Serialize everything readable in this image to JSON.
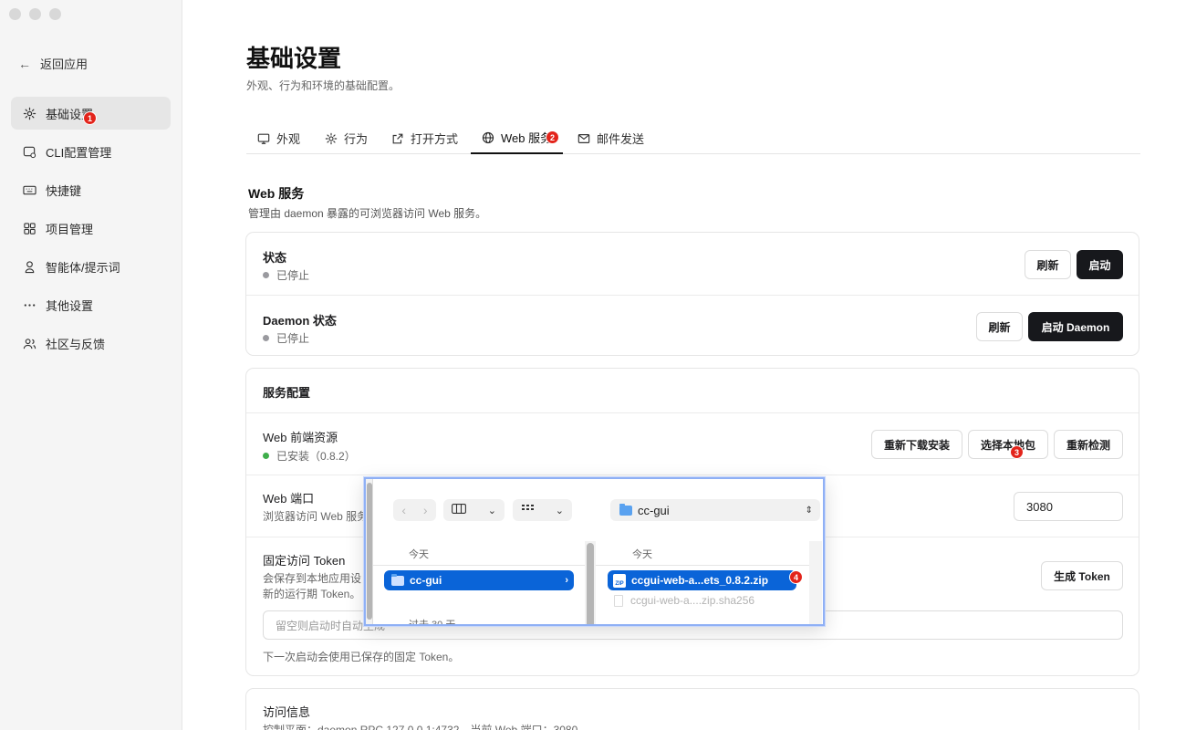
{
  "sidebar": {
    "back_label": "返回应用",
    "items": [
      {
        "label": "基础设置",
        "icon": "gear-icon",
        "active": true
      },
      {
        "label": "CLI配置管理",
        "icon": "cli-config-icon"
      },
      {
        "label": "快捷键",
        "icon": "keyboard-icon"
      },
      {
        "label": "项目管理",
        "icon": "grid-icon"
      },
      {
        "label": "智能体/提示词",
        "icon": "agent-icon"
      },
      {
        "label": "其他设置",
        "icon": "more-icon"
      },
      {
        "label": "社区与反馈",
        "icon": "users-icon"
      }
    ]
  },
  "header": {
    "title": "基础设置",
    "subtitle": "外观、行为和环境的基础配置。"
  },
  "tabs": [
    {
      "label": "外观",
      "icon": "monitor-icon"
    },
    {
      "label": "行为",
      "icon": "gear-icon"
    },
    {
      "label": "打开方式",
      "icon": "external-link-icon"
    },
    {
      "label": "Web 服务",
      "icon": "globe-icon",
      "active": true
    },
    {
      "label": "邮件发送",
      "icon": "mail-icon"
    }
  ],
  "web_section": {
    "title": "Web 服务",
    "desc": "管理由 daemon 暴露的可浏览器访问 Web 服务。"
  },
  "status_card": {
    "status_label": "状态",
    "status_value": "已停止",
    "refresh_label": "刷新",
    "start_label": "启动",
    "daemon_label": "Daemon 状态",
    "daemon_value": "已停止",
    "daemon_refresh_label": "刷新",
    "daemon_start_label": "启动 Daemon"
  },
  "config_card": {
    "title": "服务配置",
    "frontend_label": "Web 前端资源",
    "frontend_status": "已安装（0.8.2）",
    "redownload_label": "重新下载安装",
    "choose_local_label": "选择本地包",
    "recheck_label": "重新检测",
    "port_label": "Web 端口",
    "port_desc": "浏览器访问 Web 服务",
    "port_value": "3080",
    "token_label": "固定访问 Token",
    "token_desc_1": "会保存到本地应用设",
    "token_desc_2": "新的运行期 Token。",
    "generate_token_label": "生成 Token",
    "token_placeholder": "留空则启动时自动生成",
    "token_hint": "下一次启动会使用已保存的固定 Token。"
  },
  "access_card": {
    "title": "访问信息",
    "desc": "控制平面：daemon RPC 127.0.0.1:4732，当前 Web 端口：3080"
  },
  "file_picker": {
    "location": "cc-gui",
    "left_head_today": "今天",
    "left_head_past": "过去 30 天",
    "folder_name": "cc-gui",
    "right_head_today": "今天",
    "selected_file": "ccgui-web-a...ets_0.8.2.zip",
    "other_file": "ccgui-web-a....zip.sha256"
  },
  "badges": [
    "1",
    "2",
    "3",
    "4"
  ],
  "colors": {
    "accent": "#0a64d8",
    "dark_button": "#17181c",
    "badge_red": "#e3241b",
    "installed_green": "#3fae4b"
  }
}
